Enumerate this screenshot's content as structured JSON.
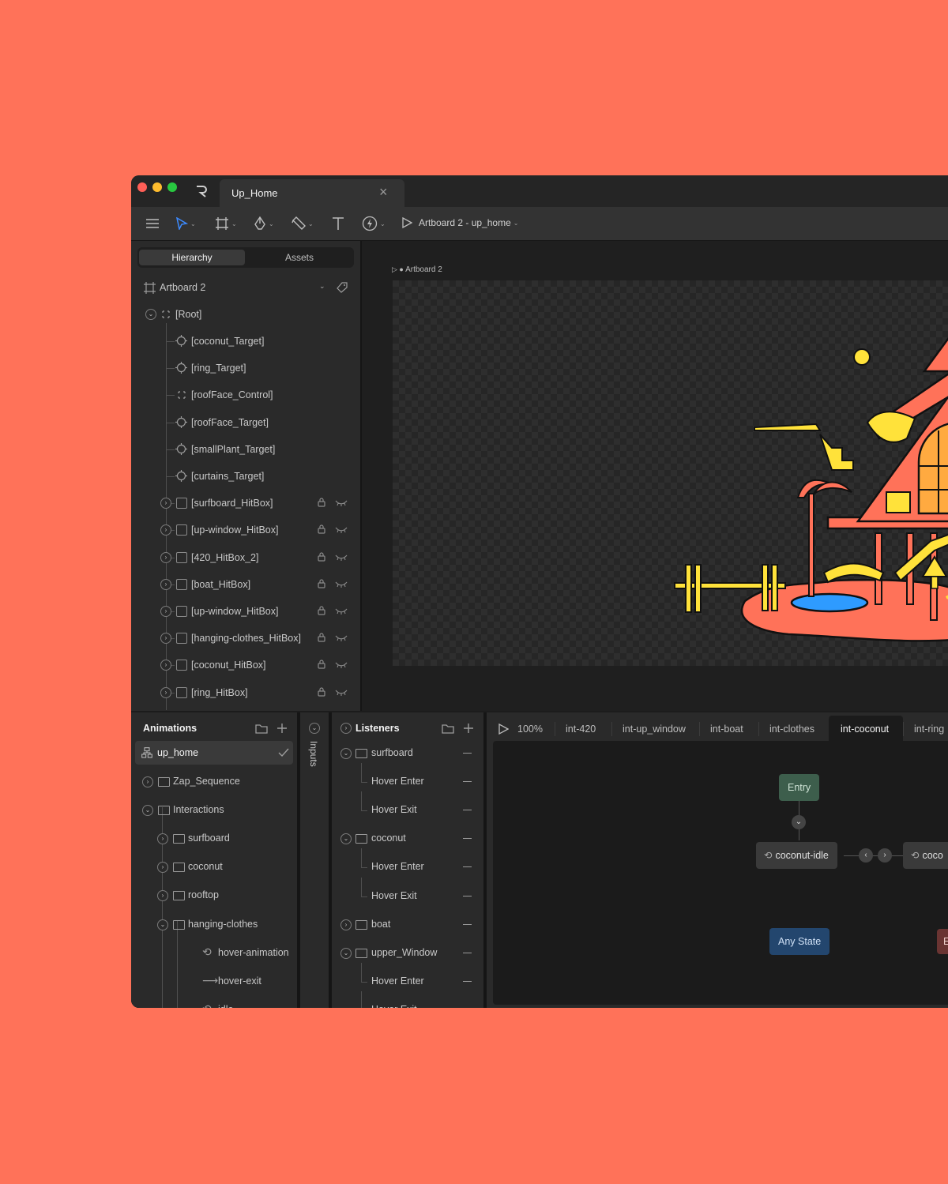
{
  "window": {
    "tab_title": "Up_Home",
    "breadcrumb": "Artboard 2 - up_home"
  },
  "hierarchy": {
    "tabs": [
      "Hierarchy",
      "Assets"
    ],
    "artboard": "Artboard 2",
    "root": "[Root]",
    "items": [
      {
        "label": "[coconut_Target]",
        "icon": "target-icon"
      },
      {
        "label": "[ring_Target]",
        "icon": "target-icon"
      },
      {
        "label": "[roofFace_Control]",
        "icon": "control-icon"
      },
      {
        "label": "[roofFace_Target]",
        "icon": "target-icon"
      },
      {
        "label": "[smallPlant_Target]",
        "icon": "target-icon"
      },
      {
        "label": "[curtains_Target]",
        "icon": "target-icon"
      },
      {
        "label": "[surfboard_HitBox]",
        "icon": "square-icon"
      },
      {
        "label": "[up-window_HitBox]",
        "icon": "square-icon"
      },
      {
        "label": "[420_HitBox_2]",
        "icon": "square-icon"
      },
      {
        "label": "[boat_HitBox]",
        "icon": "square-icon"
      },
      {
        "label": "[up-window_HitBox]",
        "icon": "square-icon"
      },
      {
        "label": "[hanging-clothes_HitBox]",
        "icon": "square-icon"
      },
      {
        "label": "[coconut_HitBox]",
        "icon": "square-icon"
      },
      {
        "label": "[ring_HitBox]",
        "icon": "square-icon"
      }
    ]
  },
  "canvas": {
    "artboard_label": "Artboard 2",
    "colors": {
      "accent": "#FF7259",
      "yellow": "#FFE23A",
      "water": "#2E9BFF"
    }
  },
  "animations": {
    "title": "Animations",
    "selected": "up_home",
    "items": [
      {
        "label": "Zap_Sequence",
        "depth": 0,
        "icon": "folder-icon",
        "chev": "›"
      },
      {
        "label": "Interactions",
        "depth": 0,
        "icon": "folder-icon",
        "chev": "⌄"
      },
      {
        "label": "surfboard",
        "depth": 1,
        "icon": "folder-icon",
        "chev": "›"
      },
      {
        "label": "coconut",
        "depth": 1,
        "icon": "folder-icon",
        "chev": "›"
      },
      {
        "label": "rooftop",
        "depth": 1,
        "icon": "folder-icon",
        "chev": "›"
      },
      {
        "label": "hanging-clothes",
        "depth": 1,
        "icon": "folder-icon",
        "chev": "⌄"
      },
      {
        "label": "hover-animation",
        "depth": 2,
        "icon": "loop-icon",
        "chev": ""
      },
      {
        "label": "hover-exit",
        "depth": 2,
        "icon": "arrow-right-icon",
        "chev": ""
      },
      {
        "label": "idle",
        "depth": 2,
        "icon": "loop-icon",
        "chev": ""
      }
    ]
  },
  "inputs": {
    "title": "Inputs"
  },
  "listeners": {
    "title": "Listeners",
    "items": [
      {
        "label": "surfboard",
        "type": "group",
        "chev": "⌄"
      },
      {
        "label": "Hover Enter",
        "type": "event"
      },
      {
        "label": "Hover Exit",
        "type": "event"
      },
      {
        "label": "coconut",
        "type": "group",
        "chev": "⌄"
      },
      {
        "label": "Hover Enter",
        "type": "event"
      },
      {
        "label": "Hover Exit",
        "type": "event"
      },
      {
        "label": "boat",
        "type": "group",
        "chev": "›"
      },
      {
        "label": "upper_Window",
        "type": "group",
        "chev": "⌄"
      },
      {
        "label": "Hover Enter",
        "type": "event"
      },
      {
        "label": "Hover Exit",
        "type": "event"
      }
    ]
  },
  "state_machine": {
    "zoom": "100%",
    "tabs": [
      "int-420",
      "int-up_window",
      "int-boat",
      "int-clothes",
      "int-coconut",
      "int-ring"
    ],
    "active_tab": "int-coconut",
    "nodes": {
      "entry": "Entry",
      "idle": "coconut-idle",
      "next": "coco",
      "any": "Any State",
      "exit": "E"
    }
  }
}
